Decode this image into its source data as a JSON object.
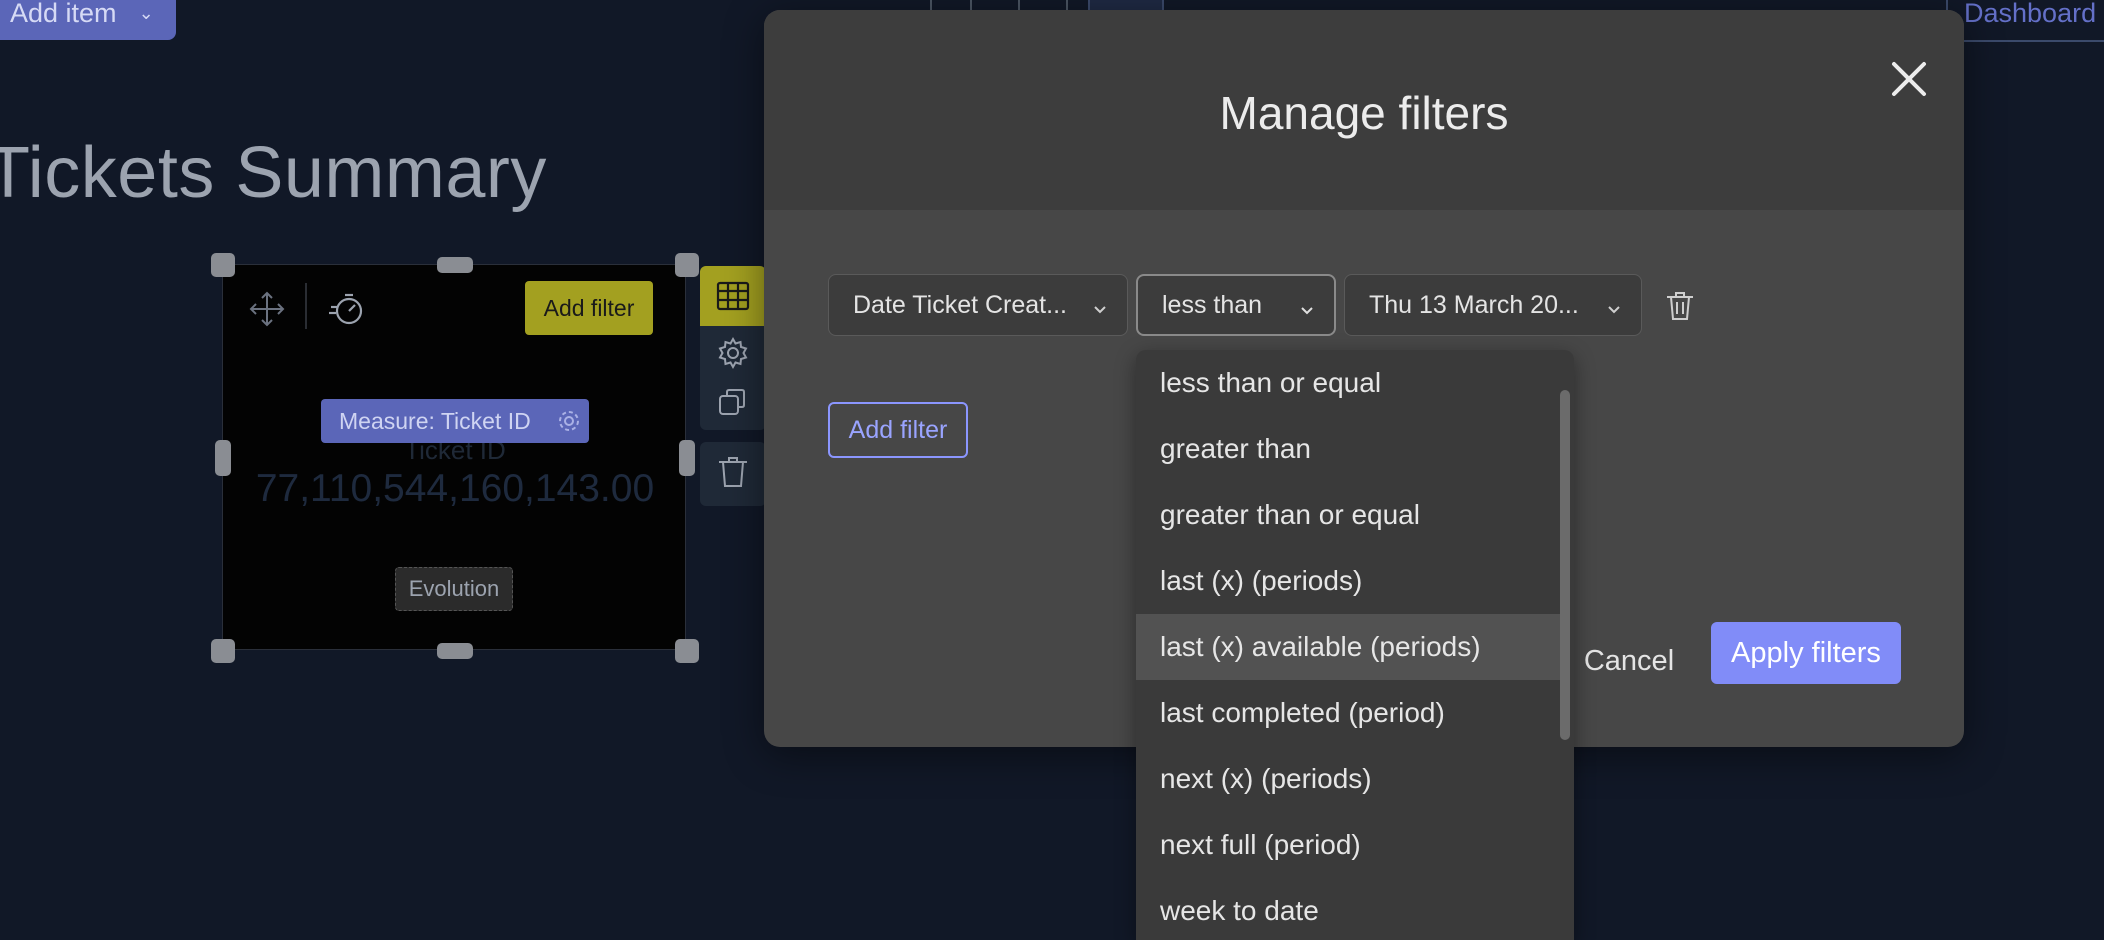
{
  "header": {
    "add_item_label": "Add item",
    "dashboard_label": "Dashboard"
  },
  "dashboard": {
    "title": "Tickets Summary",
    "widget": {
      "add_filter_label": "Add filter",
      "measure_label": "Measure: Ticket ID",
      "measure_caption": "Ticket ID",
      "value": "77,110,544,160,143.00",
      "evolution_label": "Evolution"
    }
  },
  "modal": {
    "title": "Manage filters",
    "filter": {
      "field": "Date Ticket Creat...",
      "operator": "less than",
      "value": "Thu 13 March 20..."
    },
    "add_filter_label": "Add filter",
    "cancel_label": "Cancel",
    "apply_label": "Apply filters"
  },
  "dropdown": {
    "hovered_index": 4,
    "options": [
      "less than or equal",
      "greater than",
      "greater than or equal",
      "last (x) (periods)",
      "last (x) available (periods)",
      "last completed (period)",
      "next (x) (periods)",
      "next full (period)",
      "week to date"
    ]
  },
  "colors": {
    "background": "#111827",
    "accent_primary": "#818cf8",
    "accent_widget": "#a3a020",
    "modal_bg": "#474747"
  },
  "icons": {
    "close": "close-icon",
    "caret": "chevron-down-icon",
    "trash": "trash-icon",
    "move": "move-icon",
    "speed": "stopwatch-icon",
    "table": "table-icon",
    "gear": "gear-icon",
    "copy": "copy-icon"
  }
}
